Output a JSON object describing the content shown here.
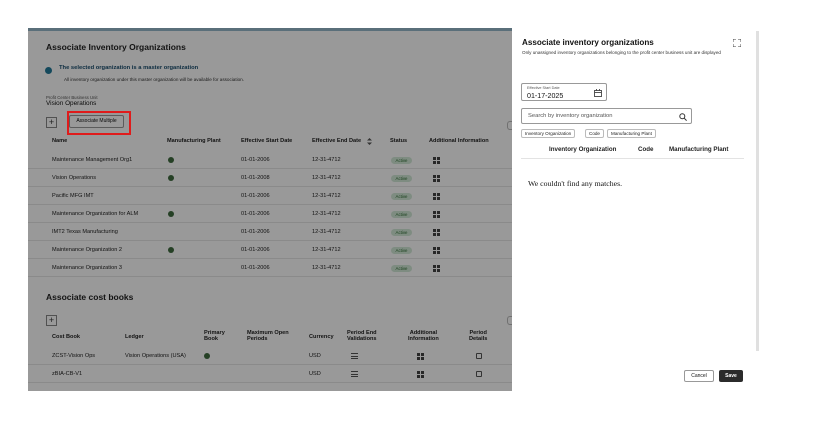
{
  "main": {
    "inventory_section": {
      "title": "Associate Inventory Organizations",
      "info_heading": "The selected organization is a master organization",
      "info_text": "All inventory organization under this master organization will be available for association.",
      "profit_center_label": "Profit Center Business Unit",
      "profit_center_value": "Vision Operations",
      "add_label": "+",
      "associate_multiple_label": "Associate Multiple",
      "columns": {
        "name": "Name",
        "manufacturing_plant": "Manufacturing Plant",
        "effective_start": "Effective Start Date",
        "effective_end": "Effective End Date",
        "status": "Status",
        "additional_info": "Additional Information",
        "sort_icon": "sort-icon"
      },
      "rows": [
        {
          "name": "Maintenance Management Org1",
          "plant": true,
          "start": "01-01-2006",
          "end": "12-31-4712",
          "status": "Active"
        },
        {
          "name": "Vision Operations",
          "plant": true,
          "start": "01-01-2008",
          "end": "12-31-4712",
          "status": "Active"
        },
        {
          "name": "Pacific MFG IMT",
          "plant": false,
          "start": "01-01-2006",
          "end": "12-31-4712",
          "status": "Active"
        },
        {
          "name": "Maintenance Organization for ALM",
          "plant": true,
          "start": "01-01-2006",
          "end": "12-31-4712",
          "status": "Active"
        },
        {
          "name": "IMT2 Texas Manufacturing",
          "plant": false,
          "start": "01-01-2006",
          "end": "12-31-4712",
          "status": "Active"
        },
        {
          "name": "Maintenance Organization 2",
          "plant": true,
          "start": "01-01-2006",
          "end": "12-31-4712",
          "status": "Active"
        },
        {
          "name": "Maintenance Organization 3",
          "plant": false,
          "start": "01-01-2006",
          "end": "12-31-4712",
          "status": "Active"
        }
      ]
    },
    "cost_section": {
      "title": "Associate cost books",
      "add_label": "+",
      "columns": {
        "cost_book": "Cost Book",
        "ledger": "Ledger",
        "primary_book_1": "Primary",
        "primary_book_2": "Book",
        "max_open_1": "Maximum Open",
        "max_open_2": "Periods",
        "currency": "Currency",
        "period_end_1": "Period End",
        "period_end_2": "Validations",
        "additional_1": "Additional",
        "additional_2": "Information",
        "period_details_1": "Period",
        "period_details_2": "Details"
      },
      "rows": [
        {
          "cost_book": "ZCST-Vision Ops",
          "ledger": "Vision Operations (USA)",
          "primary": true,
          "currency": "USD"
        },
        {
          "cost_book": "zBIA-CB-V1",
          "ledger": "",
          "primary": false,
          "currency": "USD"
        }
      ]
    }
  },
  "drawer": {
    "title": "Associate inventory organizations",
    "subtitle": "Only unassigned inventory organizations belonging to the profit center business unit are displayed",
    "expand_icon": "expand-icon",
    "date_label": "Effective Start Date",
    "date_value": "01-17-2025",
    "search_placeholder": "Search by inventory organization",
    "chips": [
      "Inventory Organization",
      "Code",
      "Manufacturing Plant"
    ],
    "columns": {
      "inventory_org": "Inventory Organization",
      "code": "Code",
      "manufacturing_plant": "Manufacturing Plant"
    },
    "empty_message": "We couldn't find any matches.",
    "cancel_label": "Cancel",
    "save_label": "Save"
  },
  "colors": {
    "highlight": "#e01b1b",
    "active_badge": "#d3ead8",
    "save_button": "#2b2b2b"
  }
}
